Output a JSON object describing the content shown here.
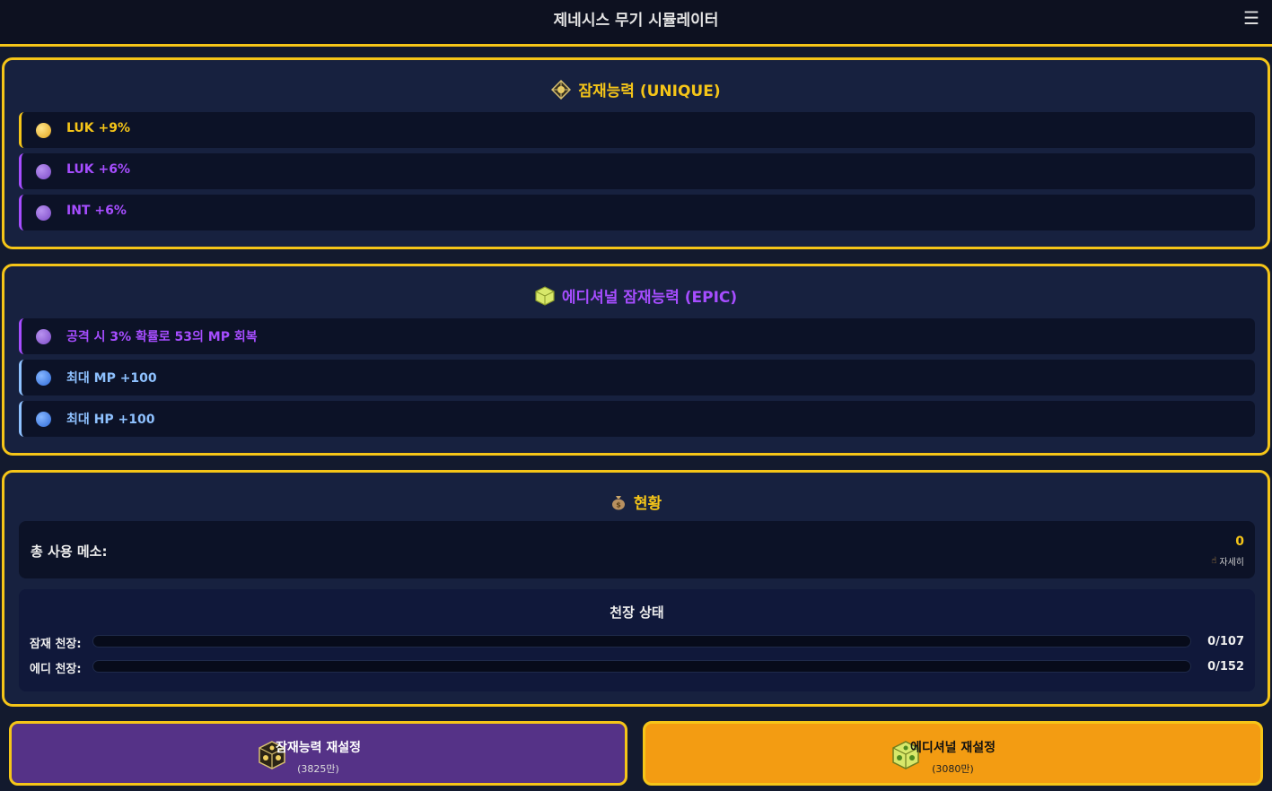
{
  "header": {
    "title": "제네시스 무기 시뮬레이터",
    "menu_icon": "☰"
  },
  "potential": {
    "title": "잠재능력 (UNIQUE)",
    "title_color": "#f5c518",
    "lines": [
      {
        "text": "LUK +9%",
        "grade": "unique",
        "color": "#f5c518"
      },
      {
        "text": "LUK +6%",
        "grade": "epic",
        "color": "#a64dff"
      },
      {
        "text": "INT +6%",
        "grade": "epic",
        "color": "#a64dff"
      }
    ]
  },
  "additional": {
    "title": "에디셔널 잠재능력 (EPIC)",
    "title_color": "#a64dff",
    "lines": [
      {
        "text": "공격 시 3% 확률로 53의 MP 회복",
        "grade": "epic",
        "color": "#a64dff"
      },
      {
        "text": "최대 MP +100",
        "grade": "rare",
        "color": "#8ec1ff"
      },
      {
        "text": "최대 HP +100",
        "grade": "rare",
        "color": "#8ec1ff"
      }
    ]
  },
  "status": {
    "title": "현황",
    "total_mesos_label": "총 사용 메소:",
    "total_mesos_value": "0",
    "detail_label": "자세히",
    "pity_title": "천장 상태",
    "pity": [
      {
        "label": "잠재 천장:",
        "value": "0/107",
        "progress": 0
      },
      {
        "label": "에디 천장:",
        "value": "0/152",
        "progress": 0
      }
    ]
  },
  "buttons": {
    "potential_reset": {
      "label": "잠재능력 재설정",
      "cost": "(3825만)",
      "bg": "#553287"
    },
    "additional_reset": {
      "label": "에디셔널 재설정",
      "cost": "(3080만)",
      "bg": "#f39c12"
    }
  },
  "colors": {
    "accent": "#f5c518",
    "panel_bg": "#17213f",
    "row_bg": "#0c1227"
  }
}
